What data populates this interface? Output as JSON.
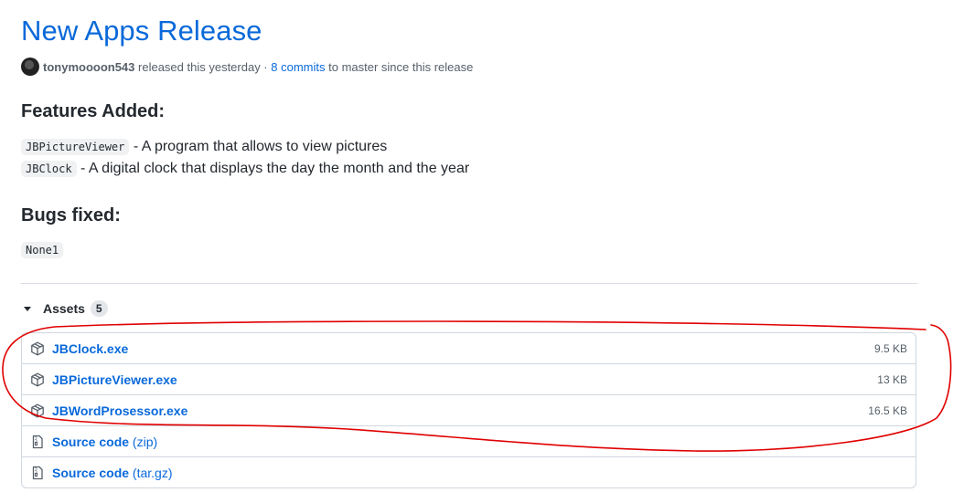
{
  "release": {
    "title": "New Apps Release",
    "author": "tonymoooon543",
    "released_text": " released this yesterday · ",
    "commits_link": "8 commits",
    "commits_suffix": " to master since this release"
  },
  "notes": {
    "features_heading": "Features Added:",
    "features": [
      {
        "code": "JBPictureViewer",
        "text": " - A program that allows to view pictures"
      },
      {
        "code": "JBClock",
        "text": " - A digital clock that displays the day the month and the year"
      }
    ],
    "bugs_heading": "Bugs fixed:",
    "bugs": [
      {
        "code": "None1"
      }
    ]
  },
  "assets": {
    "label": "Assets",
    "count": "5",
    "files": [
      {
        "name": "JBClock.exe",
        "size": "9.5 KB",
        "icon": "package-icon"
      },
      {
        "name": "JBPictureViewer.exe",
        "size": "13 KB",
        "icon": "package-icon"
      },
      {
        "name": "JBWordProsessor.exe",
        "size": "16.5 KB",
        "icon": "package-icon"
      }
    ],
    "sources": [
      {
        "name": "Source code",
        "ext": "(zip)",
        "icon": "file-zip-icon"
      },
      {
        "name": "Source code",
        "ext": "(tar.gz)",
        "icon": "file-zip-icon"
      }
    ]
  },
  "annotation": {
    "color": "#e00000"
  }
}
